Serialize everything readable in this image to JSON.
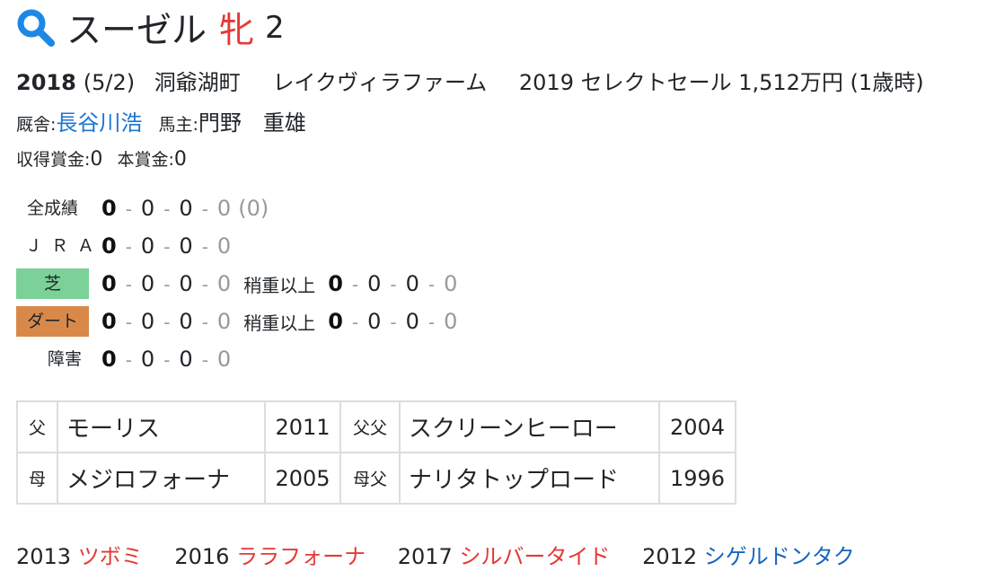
{
  "horse": {
    "name": "スーゼル",
    "sex": "牝",
    "age": "2"
  },
  "info": {
    "birth_year": "2018",
    "birth_date": "(5/2)",
    "birthplace": "洞爺湖町",
    "breeder": "レイクヴィラファーム",
    "sale": "2019 セレクトセール 1,512万円 (1歳時)"
  },
  "stable": {
    "trainer_label": "厩舎:",
    "trainer": "長谷川浩",
    "owner_label": "馬主:",
    "owner": "門野　重雄"
  },
  "prize": {
    "earned_label": "収得賞金:",
    "earned": "0",
    "main_label": "本賞金:",
    "main": "0"
  },
  "records": [
    {
      "label": "全成績",
      "n": [
        "0",
        "0",
        "0",
        "0"
      ],
      "extra": "(0)"
    },
    {
      "label": "ＪＲＡ",
      "n": [
        "0",
        "0",
        "0",
        "0"
      ]
    },
    {
      "label": "芝",
      "n": [
        "0",
        "0",
        "0",
        "0"
      ],
      "cond_label": "稍重以上",
      "cond": [
        "0",
        "0",
        "0",
        "0"
      ]
    },
    {
      "label": "ダート",
      "n": [
        "0",
        "0",
        "0",
        "0"
      ],
      "cond_label": "稍重以上",
      "cond": [
        "0",
        "0",
        "0",
        "0"
      ]
    },
    {
      "label": "障害",
      "n": [
        "0",
        "0",
        "0",
        "0"
      ]
    }
  ],
  "pedigree": {
    "sire_label": "父",
    "sire": "モーリス",
    "sire_year": "2011",
    "sire_sire_label": "父父",
    "sire_sire": "スクリーンヒーロー",
    "sire_sire_year": "2004",
    "dam_label": "母",
    "dam": "メジロフォーナ",
    "dam_year": "2005",
    "dam_sire_label": "母父",
    "dam_sire": "ナリタトップロード",
    "dam_sire_year": "1996"
  },
  "siblings": [
    {
      "year": "2013",
      "name": "ツボミ",
      "sex": "female"
    },
    {
      "year": "2016",
      "name": "ララフォーナ",
      "sex": "female"
    },
    {
      "year": "2017",
      "name": "シルバータイド",
      "sex": "female"
    },
    {
      "year": "2012",
      "name": "シゲルドンタク",
      "sex": "male"
    }
  ],
  "colors": {
    "female": "#e53935",
    "male": "#1565c0",
    "link": "#1976d2",
    "turf": "#7bd197",
    "dirt": "#d8894a",
    "icon": "#1e88e5"
  },
  "icons": {
    "title": "search-icon"
  }
}
